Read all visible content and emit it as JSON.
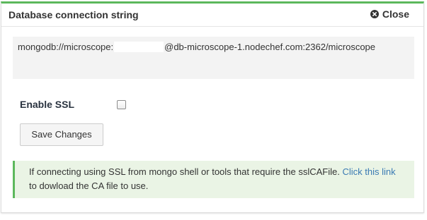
{
  "panel": {
    "title": "Database connection string",
    "close_label": "Close"
  },
  "connection": {
    "prefix": "mongodb://microscope:",
    "suffix": "@db-microscope-1.nodechef.com:2362/microscope"
  },
  "ssl": {
    "label": "Enable SSL",
    "checked": false
  },
  "actions": {
    "save_label": "Save Changes"
  },
  "info": {
    "text_before": "If connecting using SSL from mongo shell or tools that require the sslCAFile. ",
    "link_label": "Click this link",
    "text_after": " to dowload the CA file to use."
  },
  "colors": {
    "accent": "#5cb85c",
    "link": "#3a7ab3",
    "info_bg": "#eaf4e5"
  }
}
